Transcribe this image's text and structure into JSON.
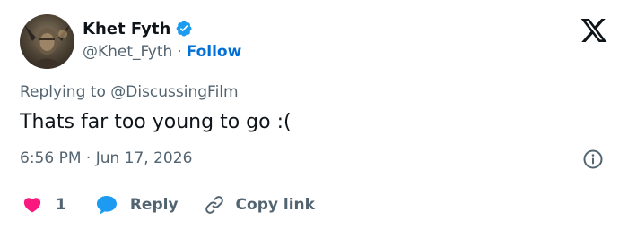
{
  "author": {
    "display_name": "Khet Fyth",
    "handle": "@Khet_Fyth",
    "separator": "·",
    "follow_label": "Follow",
    "verified": true
  },
  "reply_context": {
    "prefix": "Replying to",
    "mention": "@DiscussingFilm"
  },
  "tweet": {
    "text": "Thats far too young to go :(",
    "timestamp": "6:56 PM · Jun 17, 2026"
  },
  "actions": {
    "like_count": "1",
    "reply_label": "Reply",
    "copy_link_label": "Copy link"
  },
  "icons": {
    "verified": "verified-badge-icon",
    "brand": "x-logo-icon",
    "info": "info-icon",
    "like": "heart-icon",
    "reply": "speech-bubble-icon",
    "copy": "link-icon"
  },
  "colors": {
    "text_primary": "#0f1419",
    "text_secondary": "#536471",
    "link_blue": "#006fd6",
    "verified_blue": "#1d9bf0",
    "like_pink": "#f91880",
    "reply_blue": "#1d9bf0",
    "divider": "#cfd9de"
  }
}
